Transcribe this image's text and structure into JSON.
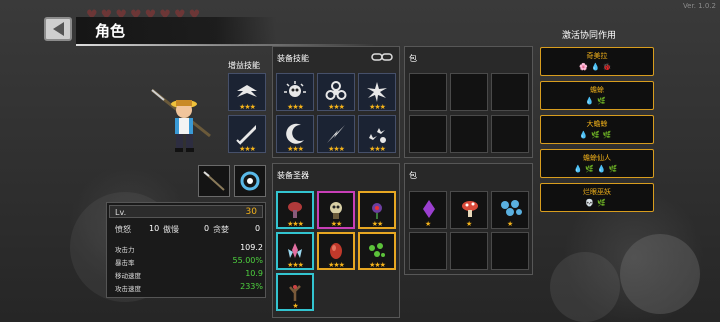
{
  "version": "Ver. 1.0.2",
  "header": {
    "title": "角色"
  },
  "hero": {
    "bonus_skill_label": "增益技能"
  },
  "stats": {
    "level_label": "Lv.",
    "level_value": "30",
    "counters": [
      {
        "label": "愤怒",
        "value": "10"
      },
      {
        "label": "傲慢",
        "value": "0"
      },
      {
        "label": "贪婪",
        "value": "0"
      }
    ],
    "rows": [
      {
        "label": "攻击力",
        "value": "109.2"
      },
      {
        "label": "暴击率",
        "value": "55.00%"
      },
      {
        "label": "移动速度",
        "value": "10.9"
      },
      {
        "label": "攻击速度",
        "value": "233%"
      }
    ]
  },
  "skills_panel": {
    "title": "装备技能",
    "bag_title": "包"
  },
  "relics_panel": {
    "title": "装备圣器",
    "bag_title": "包"
  },
  "synergy": {
    "title": "激活协同作用",
    "cards": [
      {
        "name": "奇美拉",
        "icons": "🌸💧🐞"
      },
      {
        "name": "蟾蜍",
        "icons": "💧🌿"
      },
      {
        "name": "大蟾蜍",
        "icons": "💧🌿🌿"
      },
      {
        "name": "蟾蜍仙人",
        "icons": "💧🌿💧🌿"
      },
      {
        "name": "烂眼巫妖",
        "icons": "💀🌿"
      }
    ]
  },
  "colors": {
    "accent_gold": "#f3b21a",
    "stat_green": "#4ed13f",
    "frame_cyan": "#33c4d0",
    "frame_pink": "#c93fb7"
  }
}
